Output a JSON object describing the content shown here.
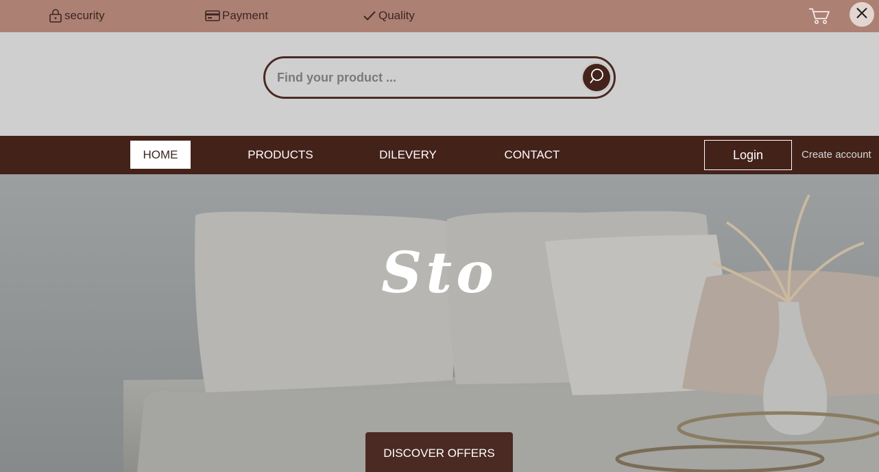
{
  "topbar": {
    "features": [
      {
        "icon": "lock-icon",
        "label": "security"
      },
      {
        "icon": "credit-card-icon",
        "label": "Payment"
      },
      {
        "icon": "checkmark-icon",
        "label": "Quality"
      }
    ],
    "cart_icon": "cart-icon",
    "close_icon": "close-icon"
  },
  "search": {
    "placeholder": "Find your product ...",
    "value": "",
    "button_icon": "search-icon"
  },
  "nav": {
    "items": [
      {
        "label": "HOME",
        "active": true
      },
      {
        "label": "PRODUCTS",
        "active": false
      },
      {
        "label": "DILEVERY",
        "active": false
      },
      {
        "label": "CONTACT",
        "active": false
      }
    ],
    "login_label": "Login",
    "create_account_label": "Create account"
  },
  "hero": {
    "title": "Sto",
    "cta_label": "DISCOVER OFFERS"
  },
  "colors": {
    "topbar": "#ad8074",
    "nav": "#43221a",
    "accent": "#4a2a22",
    "search_band": "#cfcfcf"
  }
}
